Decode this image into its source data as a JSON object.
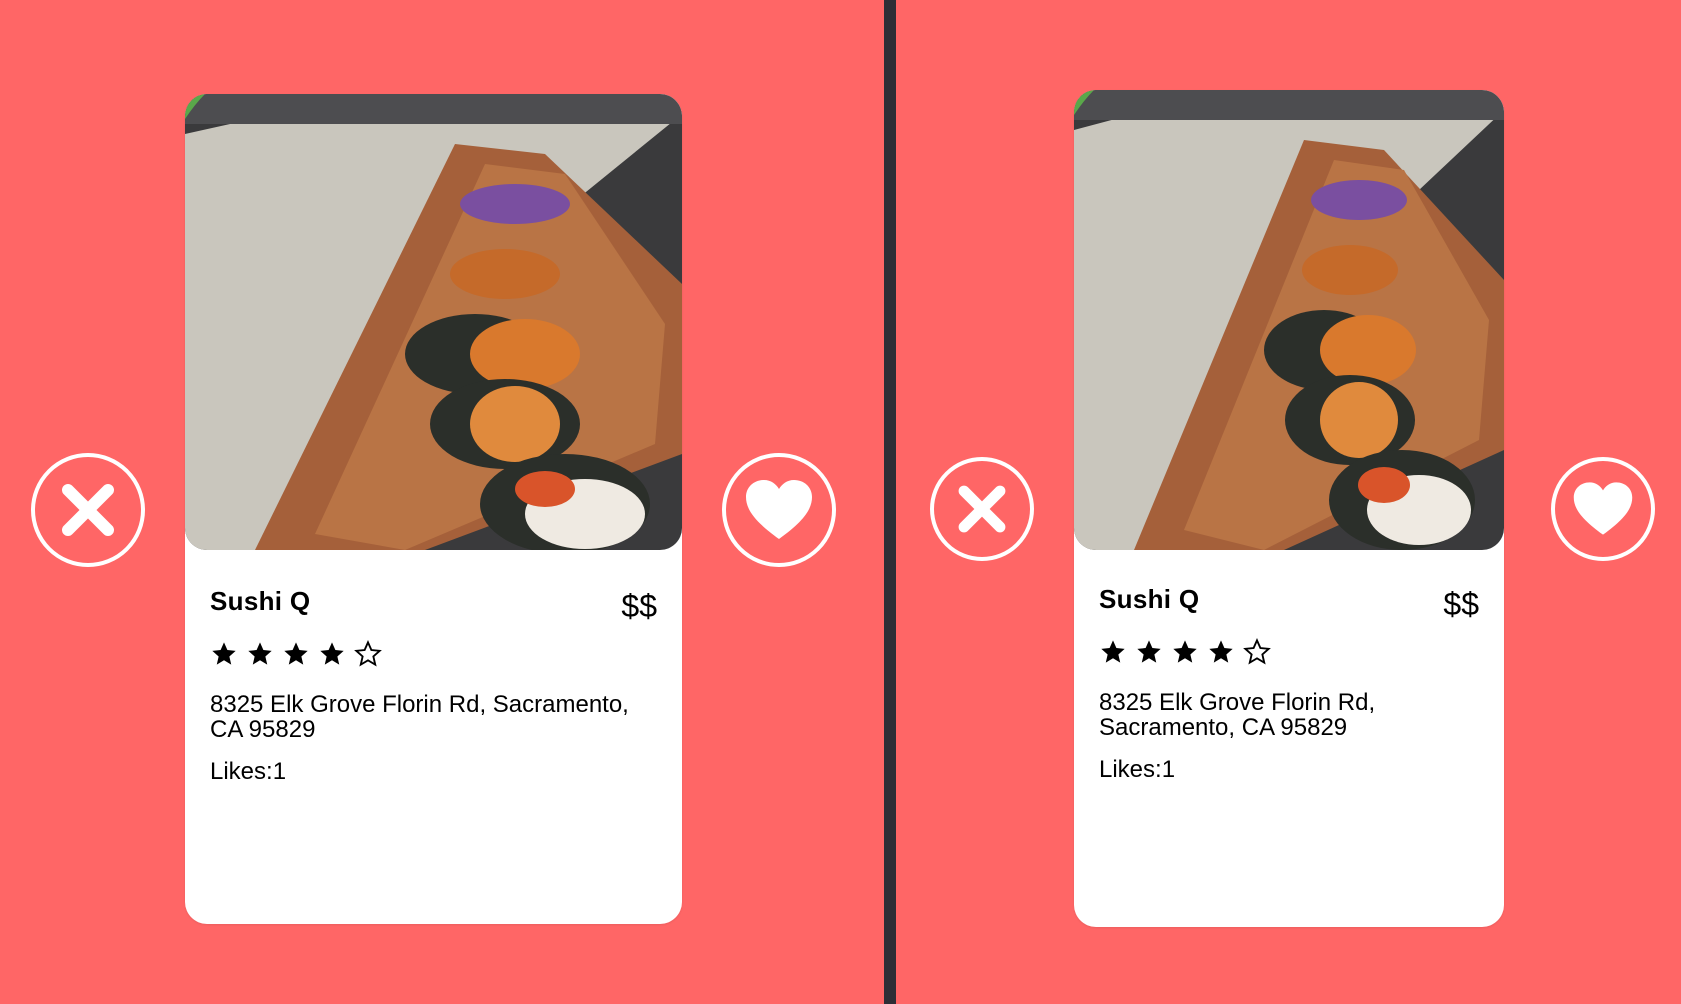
{
  "colors": {
    "background": "#ff6666",
    "divider": "#2d2e36",
    "card": "#ffffff",
    "button_outline": "#ffffff"
  },
  "panels": [
    {
      "card": {
        "name": "Sushi Q",
        "price": "$$",
        "rating": 4,
        "rating_max": 5,
        "address": "8325 Elk Grove Florin Rd, Sacramento, CA 95829",
        "likes": "Likes:1",
        "photo_icon": "sushi-photo"
      },
      "dislike_icon": "close-icon",
      "like_icon": "heart-icon"
    },
    {
      "card": {
        "name": "Sushi Q",
        "price": "$$",
        "rating": 4,
        "rating_max": 5,
        "address": "8325 Elk Grove Florin Rd, Sacramento, CA 95829",
        "likes": "Likes:1",
        "photo_icon": "sushi-photo"
      },
      "dislike_icon": "close-icon",
      "like_icon": "heart-icon"
    }
  ]
}
